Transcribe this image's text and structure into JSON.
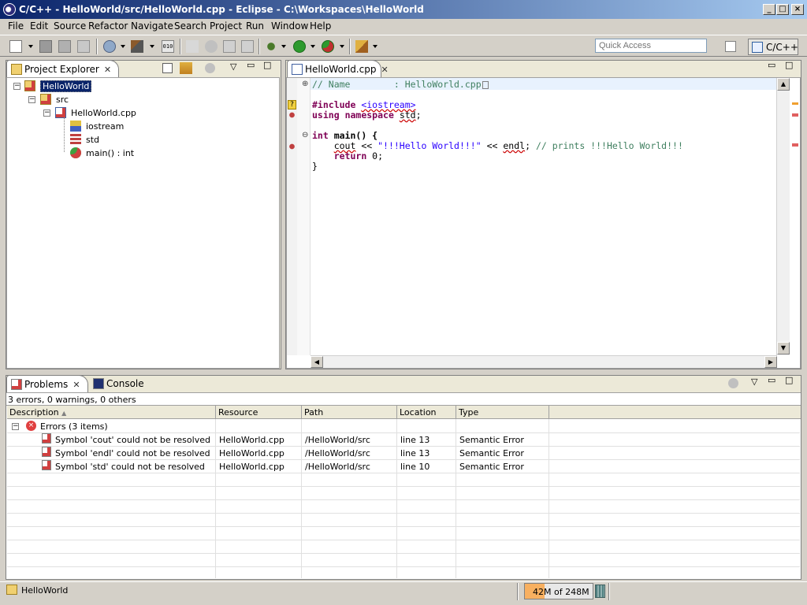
{
  "window": {
    "title": "C/C++ - HelloWorld/src/HelloWorld.cpp - Eclipse - C:\\Workspaces\\HelloWorld"
  },
  "menu": [
    "File",
    "Edit",
    "Source",
    "Refactor",
    "Navigate",
    "Search",
    "Project",
    "Run",
    "Window",
    "Help"
  ],
  "toolbar": {
    "quick_access_placeholder": "Quick Access",
    "perspective": "C/C++"
  },
  "project_explorer": {
    "tab": "Project Explorer",
    "tree": [
      {
        "label": "HelloWorld",
        "icon": "project-icon"
      },
      {
        "label": "src",
        "icon": "source-folder-icon"
      },
      {
        "label": "HelloWorld.cpp",
        "icon": "cpp-file-icon"
      },
      {
        "label": "iostream",
        "icon": "include-icon"
      },
      {
        "label": "std",
        "icon": "namespace-icon"
      },
      {
        "label": "main() : int",
        "icon": "function-icon"
      }
    ]
  },
  "editor": {
    "tab": "HelloWorld.cpp",
    "lines": {
      "l1": "// Name        : HelloWorld.cpp",
      "l2_kw": "#include",
      "l2_rest": "<iostream>",
      "l3_kw1": "using",
      "l3_kw2": "namespace",
      "l3_id": "std",
      "l4_kw": "int",
      "l4_rest": " main() {",
      "l5_cout": "cout",
      "l5_op1": " << ",
      "l5_str": "\"!!!Hello World!!!\"",
      "l5_op2": " << ",
      "l5_endl": "endl",
      "l5_semi": "; ",
      "l5_cm": "// prints !!!Hello World!!!",
      "l6_kw": "return",
      "l6_rest": " 0;",
      "l7": "}"
    }
  },
  "bottom": {
    "tabs": [
      "Problems",
      "Console"
    ],
    "summary": "3 errors, 0 warnings, 0 others",
    "columns": [
      "Description",
      "Resource",
      "Path",
      "Location",
      "Type"
    ],
    "group": "Errors (3 items)",
    "rows": [
      {
        "description": "Symbol 'cout' could not be resolved",
        "resource": "HelloWorld.cpp",
        "path": "/HelloWorld/src",
        "location": "line 13",
        "type": "Semantic Error"
      },
      {
        "description": "Symbol 'endl' could not be resolved",
        "resource": "HelloWorld.cpp",
        "path": "/HelloWorld/src",
        "location": "line 13",
        "type": "Semantic Error"
      },
      {
        "description": "Symbol 'std' could not be resolved",
        "resource": "HelloWorld.cpp",
        "path": "/HelloWorld/src",
        "location": "line 10",
        "type": "Semantic Error"
      }
    ]
  },
  "status": {
    "selection": "HelloWorld",
    "heap": "42M of 248M",
    "heap_fraction": 0.17
  }
}
